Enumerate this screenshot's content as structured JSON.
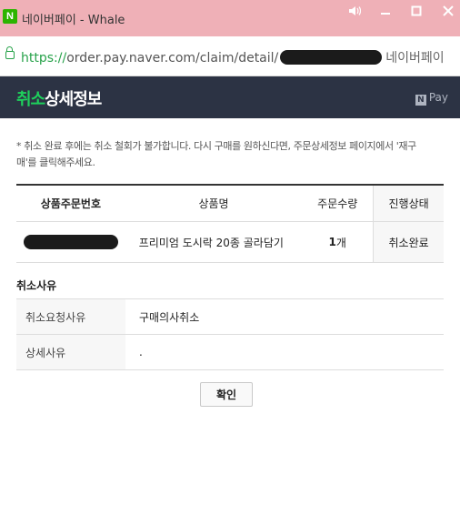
{
  "window": {
    "app_icon": "N",
    "title": "네이버페이 - Whale",
    "controls": [
      "speaker-icon",
      "minimize-icon",
      "maximize-icon",
      "close-icon"
    ]
  },
  "address": {
    "protocol": "https://",
    "url_path": "order.pay.naver.com/claim/detail/",
    "site_label": "네이버페이"
  },
  "header": {
    "title_accent": "취소",
    "title_rest": "상세정보",
    "brand_n": "N",
    "brand_text": "Pay"
  },
  "notice": "* 취소 완료 후에는 취소 철회가 불가합니다. 다시 구매를 원하신다면, 주문상세정보 페이지에서 '재구매'를 클릭해주세요.",
  "order_table": {
    "headers": [
      "상품주문번호",
      "상품명",
      "주문수량",
      "진행상태"
    ],
    "row": {
      "product_name": "프리미엄 도시락 20종 골라담기",
      "quantity": "1",
      "quantity_unit": "개",
      "status": "취소완료"
    }
  },
  "cancel_reason": {
    "section_title": "취소사유",
    "rows": [
      {
        "label": "취소요청사유",
        "value": "구매의사취소"
      },
      {
        "label": "상세사유",
        "value": "."
      }
    ]
  },
  "confirm_label": "확인",
  "colors": {
    "titlebar": "#efb0b7",
    "header_bg": "#2c3344",
    "accent_green": "#1ed05c"
  }
}
